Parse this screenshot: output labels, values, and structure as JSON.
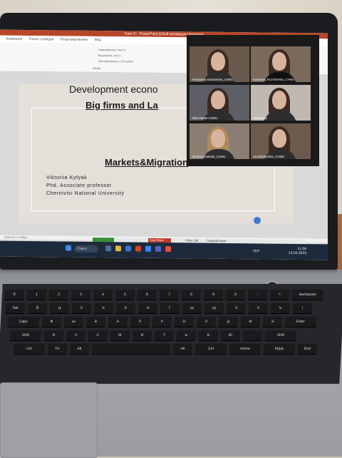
{
  "window": {
    "title": "Topic 6 – PowerPoint (Сбой активации продукта)"
  },
  "menu": [
    "Анимация",
    "Показ слайдов",
    "Рецензирование",
    "Вид"
  ],
  "ribbon": {
    "labels": [
      "Направление текста",
      "Выровнять текст",
      "Преобразовать в SmartArt",
      "Абзац"
    ]
  },
  "slide": {
    "title": "Development econo",
    "subtitle_line1": "Big firms and La",
    "subtitle_line2": "Markets&Migration",
    "author_name": "Viktoriia Kyfyak",
    "author_degree": "Phd, Associate professor",
    "author_university": "Chernivtsi National University"
  },
  "status_bar": {
    "text": "Заметки к слайду"
  },
  "zoom_bar": {
    "items": [
      "Stop Share",
      "Video Call",
      "Главный экран"
    ]
  },
  "video_call": {
    "participants": [
      {
        "name": "Anastasiia Kravtsenko_CHNU"
      },
      {
        "name": "Kateryna_Ruzichenko_CHNU"
      },
      {
        "name": "Alina Katan CHNU"
      },
      {
        "name": "Myroslava"
      },
      {
        "name": "AnnaHorchaniuk_CHNU"
      },
      {
        "name": "AnzhelaBichko_CHNU"
      }
    ]
  },
  "taskbar": {
    "search_label": "Поиск",
    "language": "УКР",
    "time": "21:06",
    "date": "13.04.2023"
  },
  "keyboard": {
    "row1": [
      "Ё",
      "1",
      "2",
      "3",
      "4",
      "5",
      "6",
      "7",
      "8",
      "9",
      "0",
      "-",
      "=",
      "Backspace"
    ],
    "row2": [
      "Tab",
      "Й",
      "Ц",
      "У",
      "К",
      "Е",
      "Н",
      "Г",
      "Ш",
      "Щ",
      "З",
      "Х",
      "Ъ",
      "\\"
    ],
    "row3": [
      "Caps",
      "Ф",
      "Ы",
      "В",
      "А",
      "П",
      "Р",
      "О",
      "Л",
      "Д",
      "Ж",
      "Э",
      "Enter"
    ],
    "row4": [
      "Shift",
      "Я",
      "Ч",
      "С",
      "М",
      "И",
      "Т",
      "Ь",
      "Б",
      "Ю",
      ".",
      "Shift"
    ],
    "row5": [
      "Ctrl",
      "Fn",
      "Alt",
      "",
      "Alt",
      "Ctrl",
      "Home",
      "PgUp",
      "End"
    ]
  }
}
